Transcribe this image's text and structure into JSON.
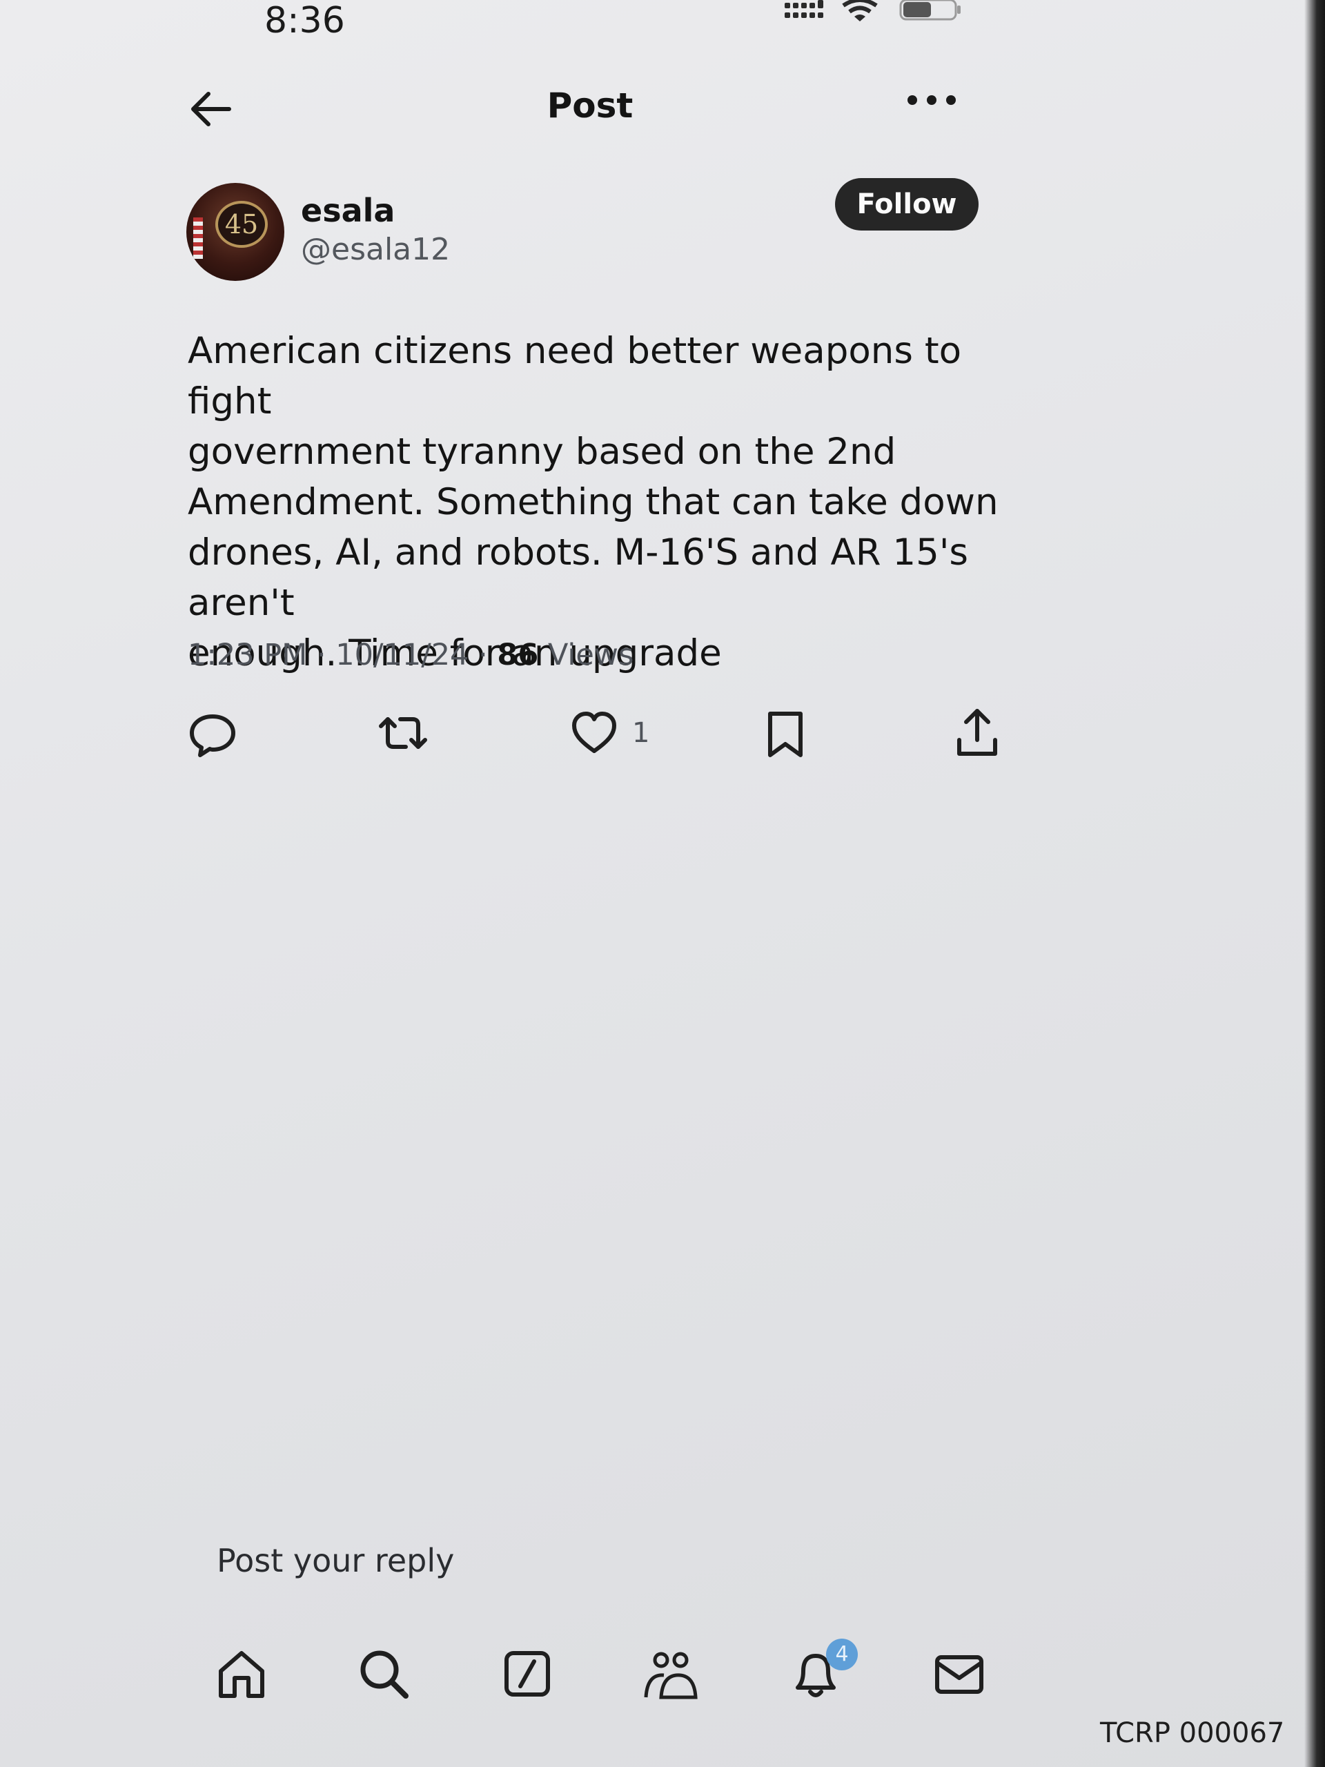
{
  "status_bar": {
    "time": "8:36",
    "icons": [
      "signal-dots-icon",
      "wifi-icon",
      "battery-icon"
    ]
  },
  "header": {
    "back_icon": "arrow-left-icon",
    "title": "Post",
    "more_icon": "more-horizontal-icon"
  },
  "author": {
    "avatar_badge": "45",
    "display_name": "esala",
    "handle": "@esala12",
    "follow_label": "Follow"
  },
  "post": {
    "text": "American citizens need better weapons to fight\ngovernment tyranny based on the 2nd\nAmendment. Something that can take down\ndrones, AI, and robots. M-16'S and AR 15's aren't\nenough. Time for an upgrade",
    "time": "1:23 PM",
    "date": "10/11/24",
    "views_count": "86",
    "views_label": "Views"
  },
  "actions": {
    "reply_icon": "reply-icon",
    "repost_icon": "repost-icon",
    "like_icon": "heart-icon",
    "like_count": "1",
    "bookmark_icon": "bookmark-icon",
    "share_icon": "share-icon"
  },
  "reply": {
    "placeholder": "Post your reply"
  },
  "bottom_nav": {
    "items": [
      "home-icon",
      "search-icon",
      "grok-icon",
      "communities-icon",
      "notifications-icon",
      "messages-icon"
    ],
    "notification_badge": "4"
  },
  "document_stamp": "TCRP 000067",
  "colors": {
    "follow_button": "#262626",
    "badge": "#5f9fd8",
    "text_primary": "#141414",
    "text_secondary": "#4f535a"
  }
}
